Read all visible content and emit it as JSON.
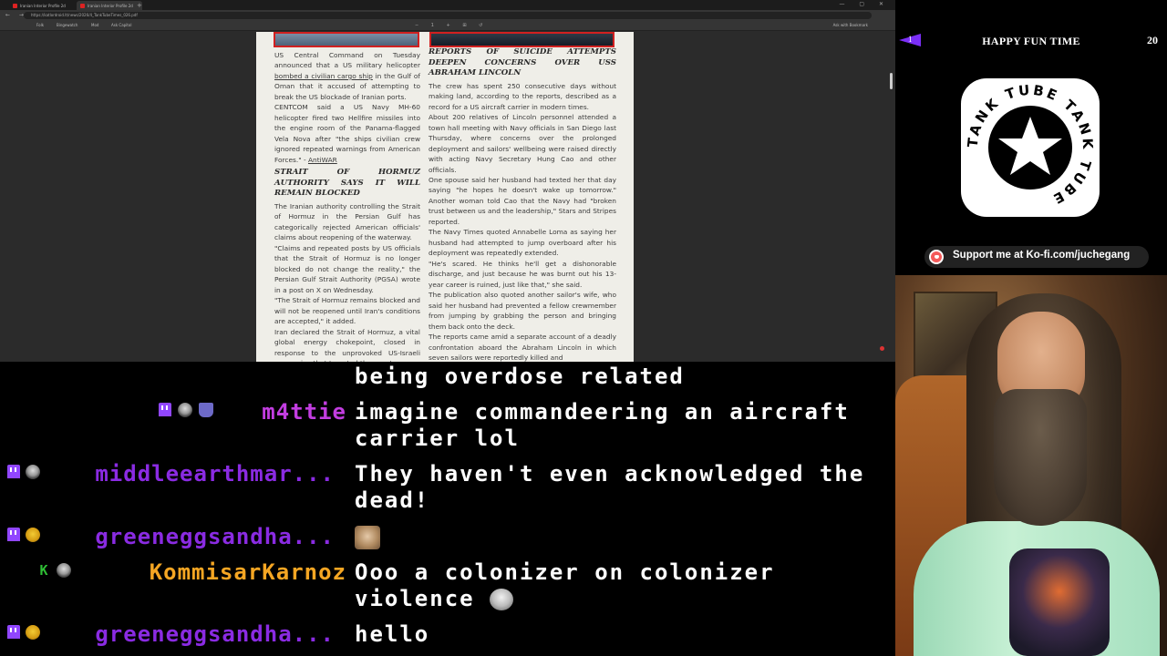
{
  "browser": {
    "tabs": [
      {
        "label": "Iranian Interior Profile 2d"
      },
      {
        "label": "Iranian Interior Profile 2d"
      }
    ],
    "new_tab": "+",
    "window_controls": "— ▢ ✕",
    "nav_buttons": "← → ⟳",
    "url": "https://katlordroid.lt/news/2026/4_TankTubeTimes_026.pdf",
    "bookmarks": [
      "Folk",
      "Bingewatch",
      "Mod",
      "Ask Capitol"
    ],
    "pdf_controls": "− 1 + ⊞ ↺",
    "pdf_right": "Ask with Bookmark"
  },
  "paper": {
    "left_col": {
      "p1_a": "US Central Command on Tuesday announced that a US military helicopter ",
      "p1_link": "bombed a civilian cargo ship",
      "p1_b": " in the Gulf of Oman that it accused of attempting to break the US blockade of Iranian ports.",
      "p2": "CENTCOM said a US Navy MH-60 helicopter fired two Hellfire missiles into the engine room of the Panama-flagged Vela Nova after \"the ships civilian crew ignored repeated warnings from American Forces.\" - ",
      "p2_src": "AntiWAR",
      "headline": "STRAIT OF HORMUZ AUTHORITY SAYS IT WILL REMAIN BLOCKED",
      "p3": "The Iranian authority controlling the Strait of Hormuz in the Persian Gulf has categorically rejected American officials' claims about reopening of the waterway.",
      "p4": "\"Claims and repeated posts by US officials that the Strait of Hormuz is no longer blocked do not change the reality,\" the Persian Gulf Strait Authority (PGSA) wrote in a post on X on Wednesday.",
      "p5": "\"The Strait of Hormuz remains blocked and will not be reopened until Iran's conditions are accepted,\" it added.",
      "p6": "Iran declared the Strait of Hormuz, a vital global energy chokepoint, closed in response to the unprovoked US-Israeli aggression that targeted the country"
    },
    "right_col": {
      "headline": "REPORTS OF SUICIDE ATTEMPTS DEEPEN CONCERNS OVER USS ABRAHAM LINCOLN",
      "p1": "The crew has spent 250 consecutive days without making land, according to the reports, described as a record for a US aircraft carrier in modern times.",
      "p2": "About 200 relatives of Lincoln personnel attended a town hall meeting with Navy officials in San Diego last Thursday, where concerns over the prolonged deployment and sailors' wellbeing were raised directly with acting Navy Secretary Hung Cao and other officials.",
      "p3": "One spouse said her husband had texted her that day saying \"he hopes he doesn't wake up tomorrow.\" Another woman told Cao that the Navy had \"broken trust between us and the leadership,\" Stars and Stripes reported.",
      "p4": "The Navy Times quoted Annabelle Loma as saying her husband had attempted to jump overboard after his deployment was repeatedly extended.",
      "p5": "\"He's scared. He thinks he'll get a dishonorable discharge, and just because he was burnt out his 13-year career is ruined, just like that,\" she said.",
      "p6": "The publication also quoted another sailor's wife, who said her husband had prevented a fellow crewmember from jumping by grabbing the person and bringing them back onto the deck.",
      "p7": "The reports came amid a separate account of a deadly confrontation aboard the Abraham Lincoln in which seven sailors were reportedly killed and"
    }
  },
  "panel": {
    "badge_number": "1",
    "title": "HAPPY FUN TIME",
    "counter": "20",
    "logo_text": "TANK TUBE TANK TUBE",
    "kofi_label": "Support me at Ko-fi.com/juchegang"
  },
  "chat": [
    {
      "user": "",
      "color": "#ffffff",
      "text": "being overdose related",
      "icons": []
    },
    {
      "user": "m4ttie",
      "color": "#c23de0",
      "text": "imagine commandeering an aircraft carrier lol",
      "icons": [
        "twitch",
        "skull",
        "cup"
      ]
    },
    {
      "user": "middleearthmar...",
      "color": "#8a2be2",
      "text": "They haven't even acknowledged the dead!",
      "icons": [
        "twitch",
        "skull"
      ]
    },
    {
      "user": "greeneggsandha...",
      "color": "#8a2be2",
      "text": "",
      "icons": [
        "twitch",
        "bee"
      ]
    },
    {
      "user": "KommisarKarnoz",
      "color": "#f5a623",
      "text": "Ooo a colonizer on colonizer violence",
      "icons": [
        "kk",
        "skull"
      ]
    },
    {
      "user": "greeneggsandha...",
      "color": "#8a2be2",
      "text": "hello",
      "icons": [
        "twitch",
        "bee"
      ]
    }
  ]
}
